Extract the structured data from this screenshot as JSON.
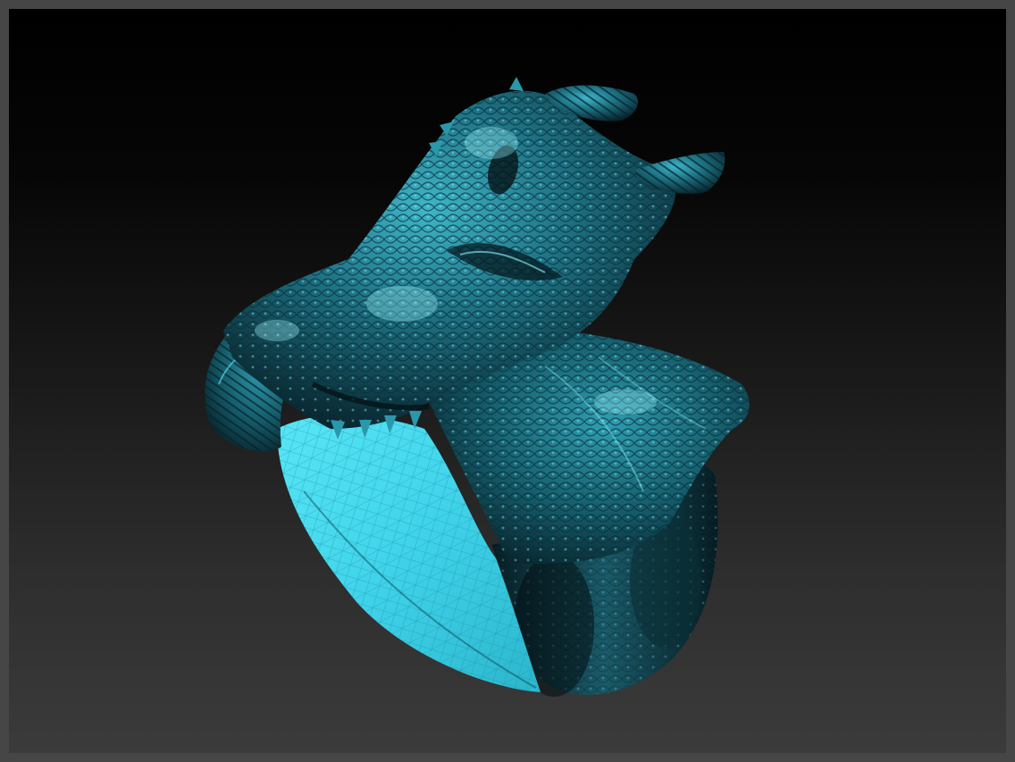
{
  "viewport": {
    "model": "dragon-ring-sculpt",
    "colors": {
      "frame": "#464646",
      "background_top": "#000000",
      "background_bottom": "#3b3b3b",
      "model_dark": "#0a2a33",
      "model_mid": "#1b6e80",
      "model_highlight": "#5fe3f5",
      "band_inner": "#3fd3ea"
    }
  }
}
